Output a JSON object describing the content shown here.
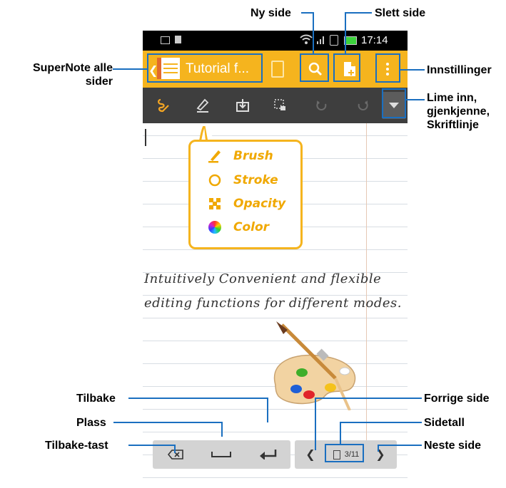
{
  "status_bar": {
    "time": "17:14"
  },
  "app_bar": {
    "title": "Tutorial f..."
  },
  "callout": {
    "items": [
      {
        "label": "Brush",
        "icon": "brush-icon"
      },
      {
        "label": "Stroke",
        "icon": "stroke-circle-icon"
      },
      {
        "label": "Opacity",
        "icon": "opacity-icon"
      },
      {
        "label": "Color",
        "icon": "color-wheel-icon"
      }
    ]
  },
  "handwriting": {
    "line1": "Intuitively Convenient and flexible",
    "line2": "editing functions for different modes."
  },
  "page_nav": {
    "page_number": "3/11"
  },
  "annotations": {
    "new_page": "Ny side",
    "delete_page": "Slett side",
    "supernote_all_pages": "SuperNote alle sider",
    "settings": "Innstillinger",
    "paste_recognize_font": "Lime inn, gjenkjenne, Skriftlinje",
    "enter": "Tilbake",
    "space": "Plass",
    "backspace": "Tilbake-tast",
    "previous_page": "Forrige side",
    "page_number": "Sidetall",
    "next_page": "Neste side"
  },
  "colors": {
    "accent": "#f5b41e",
    "annotation": "#1a6fc0",
    "toolbar": "#3e3e3e"
  }
}
